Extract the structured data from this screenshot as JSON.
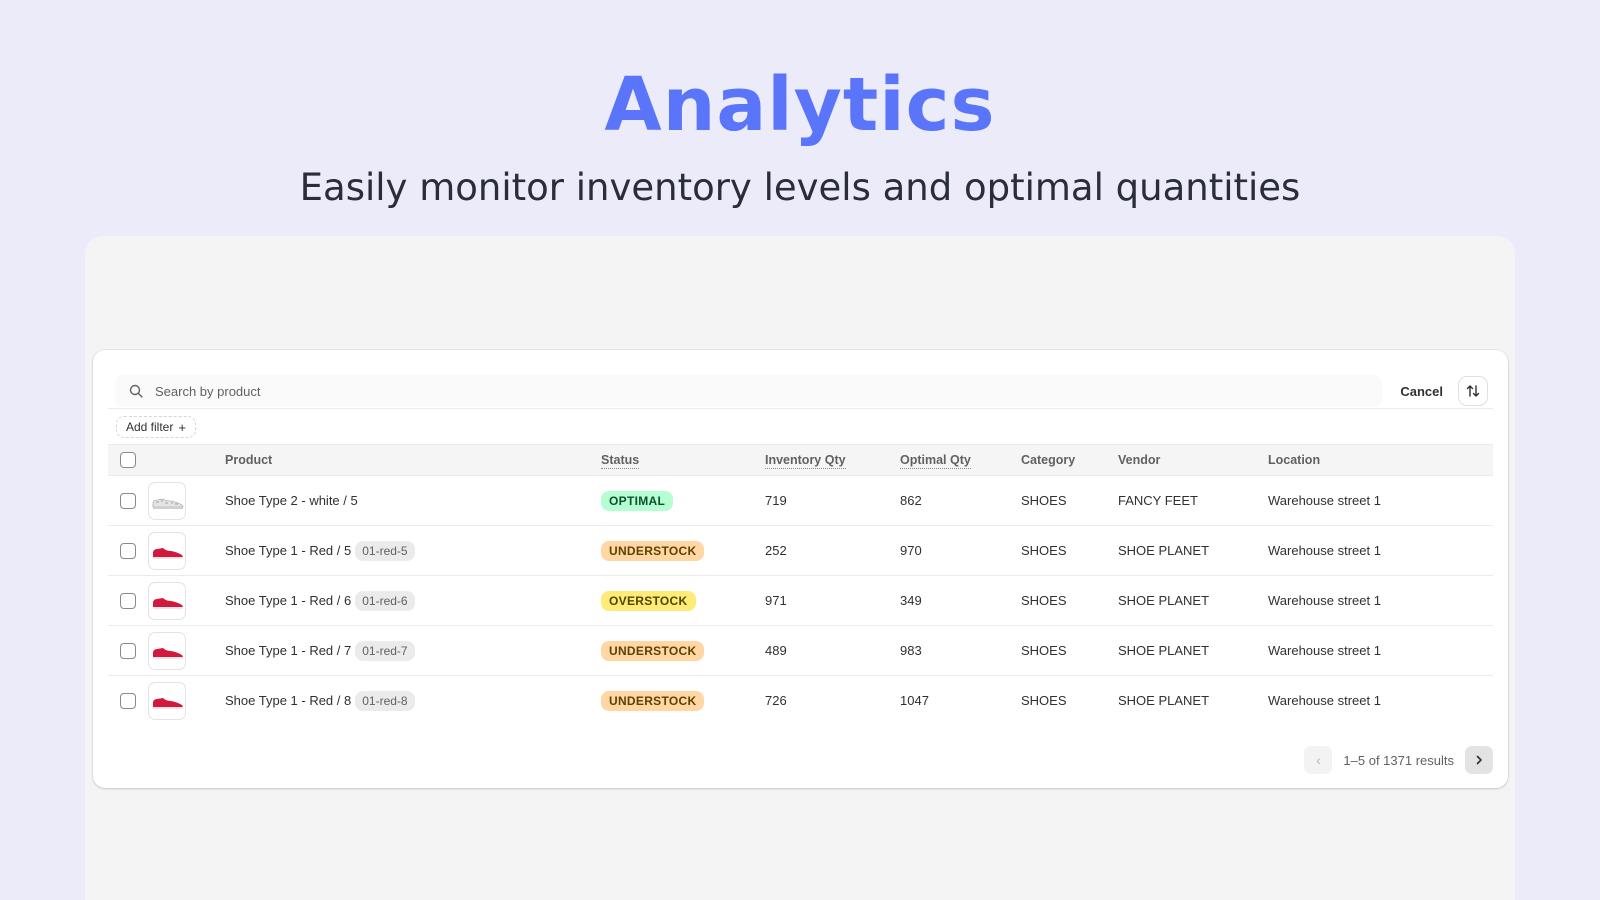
{
  "hero": {
    "title": "Analytics",
    "subtitle": "Easily monitor inventory levels and optimal quantities"
  },
  "colors": {
    "background": "#ecebf9",
    "accent": "#5a74fa",
    "optimal_bg": "#b4fed2",
    "optimal_fg": "#0c5132",
    "understock_bg": "#ffd6a4",
    "understock_fg": "#5e4200",
    "overstock_bg": "#ffeb78",
    "overstock_fg": "#4f4700"
  },
  "toolbar": {
    "search_placeholder": "Search by product",
    "search_icon": "search-icon",
    "cancel_label": "Cancel",
    "sort_icon": "sort-arrows-icon",
    "add_filter_label": "Add filter",
    "add_filter_icon": "plus-icon"
  },
  "table": {
    "columns": [
      "",
      "",
      "Product",
      "Status",
      "Inventory Qty",
      "Optimal Qty",
      "Category",
      "Vendor",
      "Location"
    ],
    "rows": [
      {
        "product": "Shoe Type 2 - white / 5",
        "sku": "",
        "thumb": "white",
        "status": "OPTIMAL",
        "status_type": "optimal",
        "inventory": "719",
        "optimal": "862",
        "category": "SHOES",
        "vendor": "FANCY FEET",
        "location": "Warehouse street 1"
      },
      {
        "product": "Shoe Type 1 - Red / 5",
        "sku": "01-red-5",
        "thumb": "red",
        "status": "UNDERSTOCK",
        "status_type": "understock",
        "inventory": "252",
        "optimal": "970",
        "category": "SHOES",
        "vendor": "SHOE PLANET",
        "location": "Warehouse street 1"
      },
      {
        "product": "Shoe Type 1 - Red / 6",
        "sku": "01-red-6",
        "thumb": "red",
        "status": "OVERSTOCK",
        "status_type": "overstock",
        "inventory": "971",
        "optimal": "349",
        "category": "SHOES",
        "vendor": "SHOE PLANET",
        "location": "Warehouse street 1"
      },
      {
        "product": "Shoe Type 1 - Red / 7",
        "sku": "01-red-7",
        "thumb": "red",
        "status": "UNDERSTOCK",
        "status_type": "understock",
        "inventory": "489",
        "optimal": "983",
        "category": "SHOES",
        "vendor": "SHOE PLANET",
        "location": "Warehouse street 1"
      },
      {
        "product": "Shoe Type 1 - Red / 8",
        "sku": "01-red-8",
        "thumb": "red",
        "status": "UNDERSTOCK",
        "status_type": "understock",
        "inventory": "726",
        "optimal": "1047",
        "category": "SHOES",
        "vendor": "SHOE PLANET",
        "location": "Warehouse street 1"
      }
    ]
  },
  "pagination": {
    "label": "1–5 of 1371 results",
    "prev_icon": "chevron-left-icon",
    "next_icon": "chevron-right-icon"
  }
}
